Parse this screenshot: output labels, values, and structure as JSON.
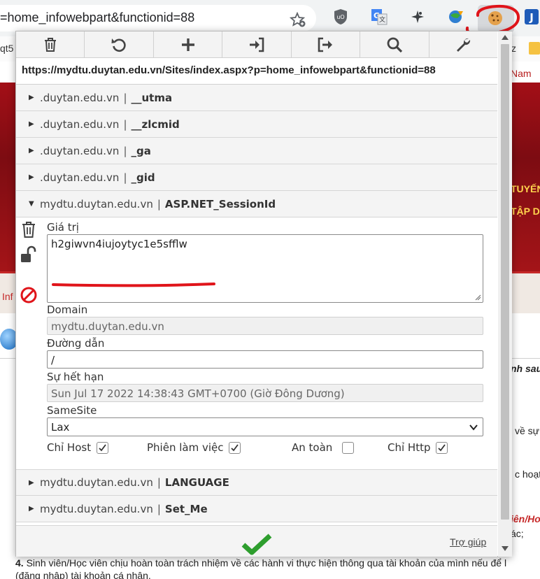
{
  "browser": {
    "address_text": "=home_infowebpart&functionid=88",
    "bookmark_left": "qt5",
    "bookmark_right": "z"
  },
  "background_page": {
    "nam": "Nam",
    "header_line1": "TUYẾN",
    "header_line2": "TẬP D",
    "info_tab": "Inf",
    "right_fragments": [
      "nh sau",
      "về sự",
      "c hoạt",
      "iên/Ho",
      "ác;"
    ],
    "bottom_line1_num": "4.",
    "bottom_line1": "Sinh viên/Học viên chịu hoàn toàn trách nhiệm về các hành vi thực hiện thông qua tài khoản của mình nếu để l",
    "bottom_line2": "(đăng nhập) tài khoản cá nhân."
  },
  "popup": {
    "toolbar": {
      "delete": "trash-icon",
      "undo": "undo-icon",
      "add": "plus-icon",
      "import": "import-icon",
      "export": "export-icon",
      "search": "search-icon",
      "options": "wrench-icon"
    },
    "url": "https://mydtu.duytan.edu.vn/Sites/index.aspx?p=home_infowebpart&functionid=88",
    "separator": "|",
    "cookies_top": [
      {
        "domain": ".duytan.edu.vn",
        "name": "__utma"
      },
      {
        "domain": ".duytan.edu.vn",
        "name": "__zlcmid"
      },
      {
        "domain": ".duytan.edu.vn",
        "name": "_ga"
      },
      {
        "domain": ".duytan.edu.vn",
        "name": "_gid"
      }
    ],
    "expanded": {
      "domain": "mydtu.duytan.edu.vn",
      "name": "ASP.NET_SessionId",
      "value_label": "Giá trị",
      "value": "h2giwvn4iujoytyc1e5sfflw",
      "domain_label": "Domain",
      "domain_value": "mydtu.duytan.edu.vn",
      "path_label": "Đường dẫn",
      "path_value": "/",
      "expires_label": "Sự hết hạn",
      "expires_value": "Sun Jul 17 2022 14:38:43 GMT+0700 (Giờ Đông Dương)",
      "samesite_label": "SameSite",
      "samesite_value": "Lax",
      "hostonly_label": "Chỉ Host",
      "hostonly": true,
      "session_label": "Phiên làm việc",
      "session": true,
      "secure_label": "An toàn",
      "secure": false,
      "httponly_label": "Chỉ Http",
      "httponly": true
    },
    "cookies_bottom": [
      {
        "domain": "mydtu.duytan.edu.vn",
        "name": "LANGUAGE"
      },
      {
        "domain": "mydtu.duytan.edu.vn",
        "name": "Set_Me"
      }
    ],
    "help_link": "Trợ giúp"
  },
  "colors": {
    "accent_red": "#e0141a",
    "check_green": "#2e9e2e"
  }
}
